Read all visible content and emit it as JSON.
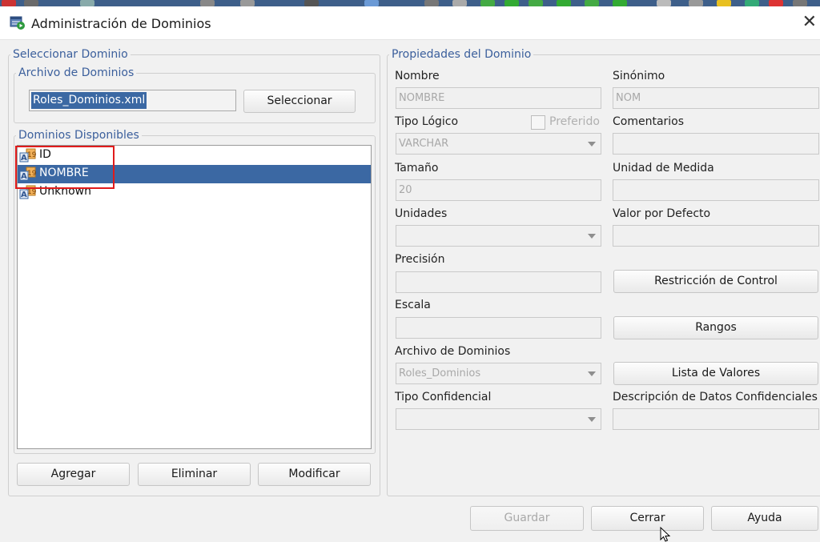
{
  "window": {
    "title": "Administración de Dominios",
    "icon": "domain-admin-icon",
    "close_label": "✕"
  },
  "left": {
    "section_title": "Seleccionar Dominio",
    "file_group_title": "Archivo de Dominios",
    "file_value": "Roles_Dominios.xml",
    "select_button": "Seleccionar",
    "available_title": "Dominios Disponibles",
    "domains": [
      {
        "label": "ID",
        "selected": false
      },
      {
        "label": "NOMBRE",
        "selected": true
      },
      {
        "label": "Unknown",
        "selected": false
      }
    ],
    "buttons": {
      "add": "Agregar",
      "delete": "Eliminar",
      "modify": "Modificar"
    }
  },
  "props": {
    "section_title": "Propiedades del Dominio",
    "name_label": "Nombre",
    "name_value": "NOMBRE",
    "synonym_label": "Sinónimo",
    "synonym_value": "NOM",
    "logical_type_label": "Tipo Lógico",
    "preferred_label": "Preferido",
    "comments_label": "Comentarios",
    "logical_type_value": "VARCHAR",
    "size_label": "Tamaño",
    "size_value": "20",
    "unit_label": "Unidad de Medida",
    "units_label": "Unidades",
    "default_label": "Valor por Defecto",
    "precision_label": "Precisión",
    "check_button": "Restricción de Control",
    "scale_label": "Escala",
    "ranges_button": "Rangos",
    "domain_file_label": "Archivo de Dominios",
    "domain_file_value": "Roles_Dominios",
    "values_button": "Lista de Valores",
    "confidential_type_label": "Tipo Confidencial",
    "confidential_desc_label": "Descripción de Datos Confidenciales"
  },
  "footer": {
    "save": "Guardar",
    "close": "Cerrar",
    "help": "Ayuda"
  }
}
